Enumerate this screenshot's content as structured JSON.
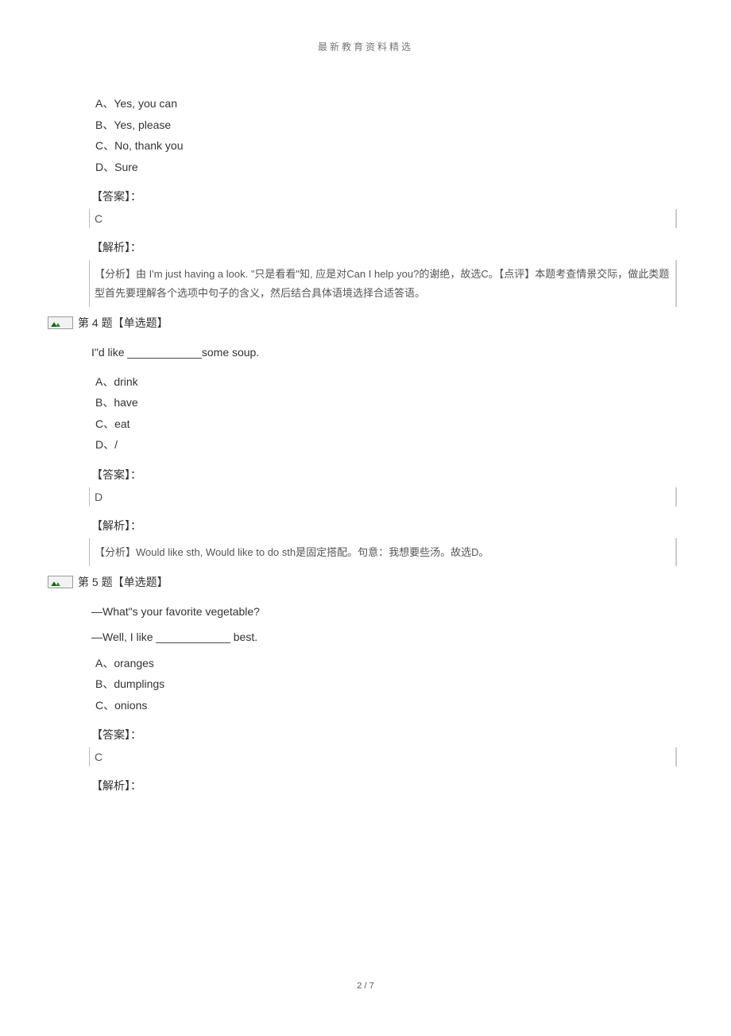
{
  "header": "最新教育资料精选",
  "footer": "2 / 7",
  "q3": {
    "options": {
      "A": "A、Yes, you can",
      "B": "B、Yes, please",
      "C": "C、No, thank you",
      "D": "D、Sure"
    },
    "answer_label": "【答案】：",
    "answer": "C",
    "analysis_label": "【解析】：",
    "analysis": "【分析】由 I'm just having a look. \"只是看看\"知, 应是对Can I help you?的谢绝，故选C。【点评】本题考查情景交际，做此类题型首先要理解各个选项中句子的含义，然后结合具体语境选择合适答语。"
  },
  "q4": {
    "header": "第 4 题【单选题】",
    "stem": "I\"d like ____________some soup.",
    "options": {
      "A": "A、drink",
      "B": "B、have",
      "C": "C、eat",
      "D": "D、/"
    },
    "answer_label": "【答案】：",
    "answer": "D",
    "analysis_label": "【解析】：",
    "analysis": "【分析】Would like sth, Would like to do sth是固定搭配。句意：我想要些汤。故选D。"
  },
  "q5": {
    "header": "第 5 题【单选题】",
    "stem1": "—What\"s your favorite vegetable?",
    "stem2": "—Well, I like ____________ best.",
    "options": {
      "A": "A、oranges",
      "B": "B、dumplings",
      "C": "C、onions"
    },
    "answer_label": "【答案】：",
    "answer": "C",
    "analysis_label": "【解析】："
  }
}
